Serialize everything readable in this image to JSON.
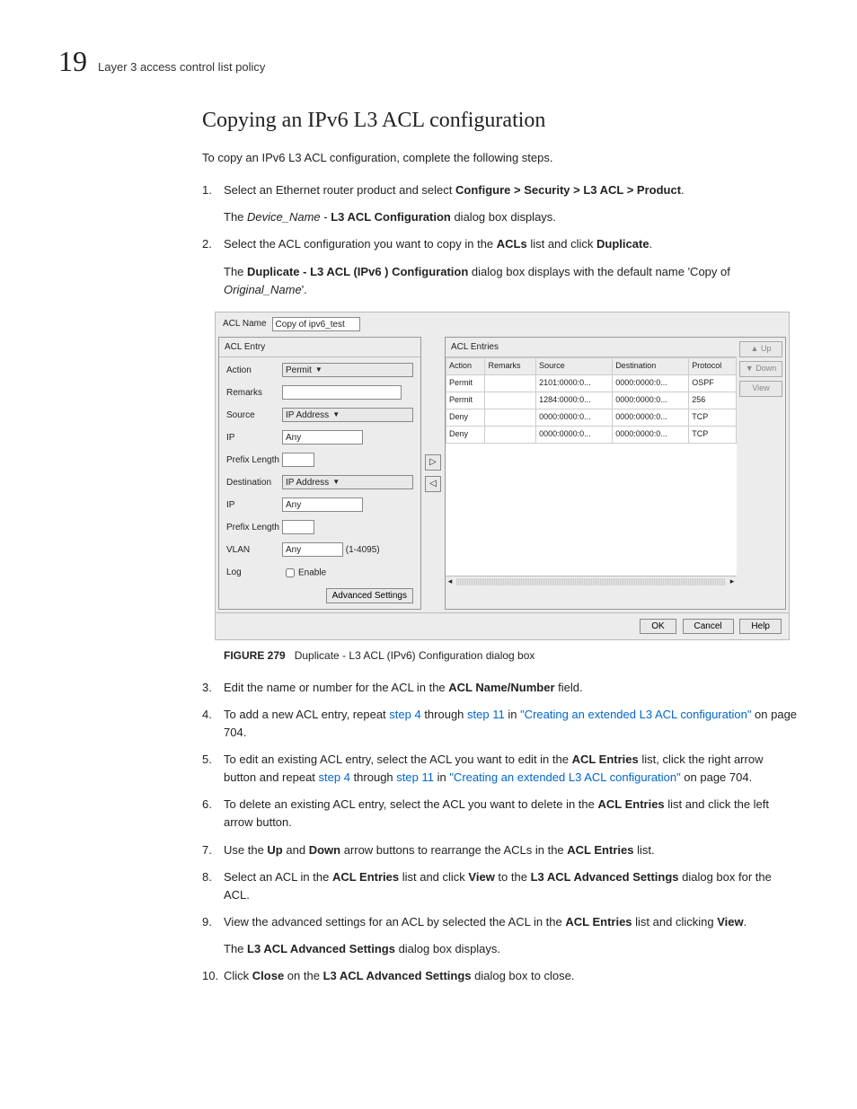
{
  "header": {
    "chapter_number": "19",
    "breadcrumb": "Layer 3 access control list policy"
  },
  "title": "Copying an IPv6 L3 ACL configuration",
  "intro": "To copy an IPv6 L3 ACL configuration, complete the following steps.",
  "steps": {
    "s1_a": "Select an Ethernet router product and select ",
    "s1_b": "Configure > Security > L3 ACL > Product",
    "s1_c": ".",
    "s1_p_a": "The ",
    "s1_p_b": "Device_Name",
    "s1_p_c": " - ",
    "s1_p_d": "L3 ACL Configuration",
    "s1_p_e": " dialog box displays.",
    "s2_a": "Select the ACL configuration you want to copy in the ",
    "s2_b": "ACLs",
    "s2_c": " list and click ",
    "s2_d": "Duplicate",
    "s2_e": ".",
    "s2_p_a": "The ",
    "s2_p_b": "Duplicate - L3 ACL (IPv6 ) Configuration",
    "s2_p_c": " dialog box displays with the default name 'Copy of ",
    "s2_p_d": "Original_Name",
    "s2_p_e": "'.",
    "s3_a": "Edit the name or number for the ACL in the ",
    "s3_b": "ACL Name/Number",
    "s3_c": " field.",
    "s4_a": "To add a new ACL entry, repeat ",
    "s4_b": "step 4",
    "s4_c": " through ",
    "s4_d": "step 11",
    "s4_e": " in ",
    "s4_f": "\"Creating an extended L3 ACL configuration\"",
    "s4_g": " on page 704.",
    "s5_a": "To edit an existing ACL entry, select the ACL you want to edit in the ",
    "s5_b": "ACL Entries",
    "s5_c": " list, click the right arrow button and repeat ",
    "s5_d": "step 4",
    "s5_e": " through ",
    "s5_f": "step 11",
    "s5_g": " in ",
    "s5_h": "\"Creating an extended L3 ACL configuration\"",
    "s5_i": " on page 704.",
    "s6_a": "To delete an existing ACL entry, select the ACL you want to delete in the ",
    "s6_b": "ACL Entries",
    "s6_c": " list and click the left arrow button.",
    "s7_a": "Use the ",
    "s7_b": "Up",
    "s7_c": " and ",
    "s7_d": "Down",
    "s7_e": " arrow buttons to rearrange the ACLs in the ",
    "s7_f": "ACL Entries",
    "s7_g": " list.",
    "s8_a": "Select an ACL in the ",
    "s8_b": "ACL Entries",
    "s8_c": " list and click ",
    "s8_d": "View",
    "s8_e": " to the ",
    "s8_f": "L3 ACL Advanced Settings",
    "s8_g": " dialog box for the ACL.",
    "s9_a": "View the advanced settings for an ACL by selected the ACL in the ",
    "s9_b": "ACL Entries",
    "s9_c": " list and clicking ",
    "s9_d": "View",
    "s9_e": ".",
    "s9_p_a": "The ",
    "s9_p_b": "L3 ACL Advanced Settings",
    "s9_p_c": " dialog box displays.",
    "s10_a": "Click ",
    "s10_b": "Close",
    "s10_c": " on the ",
    "s10_d": "L3 ACL Advanced Settings",
    "s10_e": " dialog box to close."
  },
  "figure": {
    "num": "FIGURE 279",
    "caption": "Duplicate - L3 ACL (IPv6) Configuration dialog box"
  },
  "dialog": {
    "acl_name_label": "ACL Name",
    "acl_name_value": "Copy of ipv6_test",
    "left_panel_title": "ACL Entry",
    "form": {
      "action_label": "Action",
      "action_value": "Permit",
      "remarks_label": "Remarks",
      "source_label": "Source",
      "source_value": "IP Address",
      "ip_label": "IP",
      "ip_value": "Any",
      "prefix_label": "Prefix Length",
      "dest_label": "Destination",
      "dest_value": "IP Address",
      "ip2_label": "IP",
      "ip2_value": "Any",
      "prefix2_label": "Prefix Length",
      "vlan_label": "VLAN",
      "vlan_value": "Any",
      "vlan_range": "(1-4095)",
      "log_label": "Log",
      "log_checkbox": "Enable",
      "advanced_btn": "Advanced Settings"
    },
    "right_panel_title": "ACL Entries",
    "columns": [
      "Action",
      "Remarks",
      "Source",
      "Destination",
      "Protocol"
    ],
    "rows": [
      {
        "action": "Permit",
        "remarks": "",
        "source": "2101:0000:0...",
        "dest": "0000:0000:0...",
        "proto": "OSPF"
      },
      {
        "action": "Permit",
        "remarks": "",
        "source": "1284:0000:0...",
        "dest": "0000:0000:0...",
        "proto": "256"
      },
      {
        "action": "Deny",
        "remarks": "",
        "source": "0000:0000:0...",
        "dest": "0000:0000:0...",
        "proto": "TCP"
      },
      {
        "action": "Deny",
        "remarks": "",
        "source": "0000:0000:0...",
        "dest": "0000:0000:0...",
        "proto": "TCP"
      }
    ],
    "side_buttons": {
      "up": "Up",
      "down": "Down",
      "view": "View"
    },
    "bottom_buttons": {
      "ok": "OK",
      "cancel": "Cancel",
      "help": "Help"
    }
  }
}
